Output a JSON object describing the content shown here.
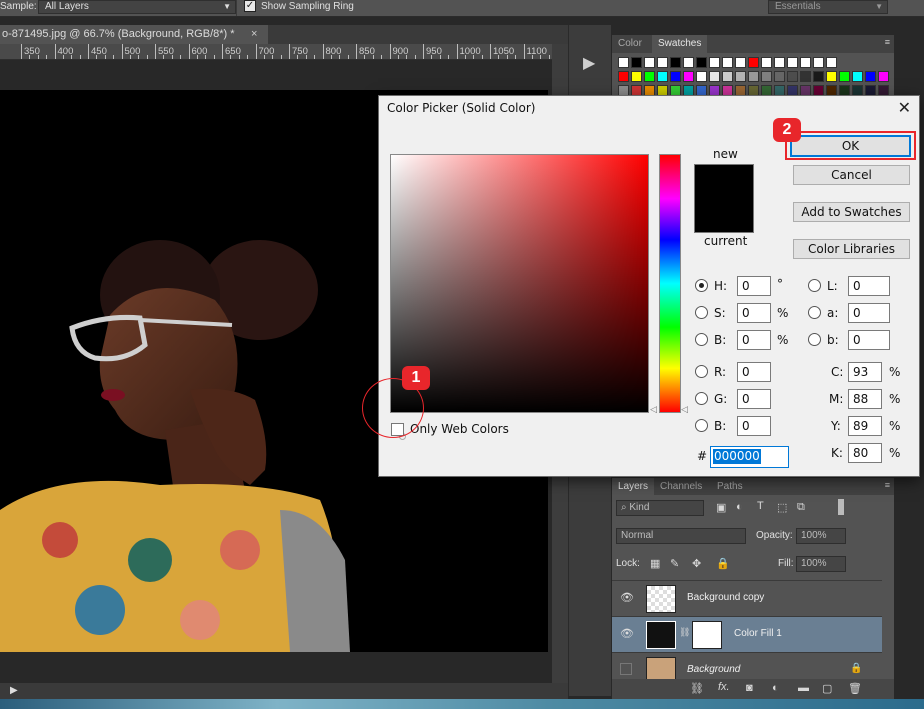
{
  "options_bar": {
    "sample_label": "Sample:",
    "sample_value": "All Layers",
    "show_sampling_ring_label": "Show Sampling Ring",
    "workspace_value": "Essentials"
  },
  "document": {
    "tab_title": "o-871495.jpg @ 66.7% (Background, RGB/8*) *",
    "close_glyph": "×",
    "ruler_ticks": [
      "350",
      "400",
      "450",
      "500",
      "550",
      "600",
      "650",
      "700",
      "750",
      "800",
      "850",
      "900",
      "950",
      "1000",
      "1050",
      "1100"
    ]
  },
  "swatches_panel": {
    "tabs": [
      "Color",
      "Swatches"
    ],
    "active_tab": "Swatches"
  },
  "layers_panel": {
    "tabs": [
      "Layers",
      "Channels",
      "Paths"
    ],
    "filter_label": "Kind",
    "blend_mode": "Normal",
    "opacity_label": "Opacity:",
    "opacity_value": "100%",
    "lock_label": "Lock:",
    "fill_label": "Fill:",
    "fill_value": "100%",
    "layers": [
      {
        "name": "Background copy"
      },
      {
        "name": "Color Fill 1"
      },
      {
        "name": "Background"
      }
    ]
  },
  "color_picker": {
    "title": "Color Picker (Solid Color)",
    "close_glyph": "✕",
    "new_label": "new",
    "current_label": "current",
    "buttons": {
      "ok": "OK",
      "cancel": "Cancel",
      "add_to_swatches": "Add to Swatches",
      "color_libraries": "Color Libraries"
    },
    "only_web_colors_label": "Only Web Colors",
    "fields_left": [
      {
        "label": "H:",
        "value": "0",
        "unit": "°"
      },
      {
        "label": "S:",
        "value": "0",
        "unit": "%"
      },
      {
        "label": "B:",
        "value": "0",
        "unit": "%"
      },
      {
        "label": "R:",
        "value": "0",
        "unit": ""
      },
      {
        "label": "G:",
        "value": "0",
        "unit": ""
      },
      {
        "label": "B:",
        "value": "0",
        "unit": ""
      }
    ],
    "fields_right": [
      {
        "label": "L:",
        "value": "0"
      },
      {
        "label": "a:",
        "value": "0"
      },
      {
        "label": "b:",
        "value": "0"
      }
    ],
    "cmyk": [
      {
        "label": "C:",
        "value": "93",
        "unit": "%"
      },
      {
        "label": "M:",
        "value": "88",
        "unit": "%"
      },
      {
        "label": "Y:",
        "value": "89",
        "unit": "%"
      },
      {
        "label": "K:",
        "value": "80",
        "unit": "%"
      }
    ],
    "hash_label": "#",
    "hex_value": "000000",
    "new_color": "#000000",
    "current_color": "#000000"
  },
  "annotations": {
    "step1": "1",
    "step2": "2",
    "color": "#e8262b"
  }
}
